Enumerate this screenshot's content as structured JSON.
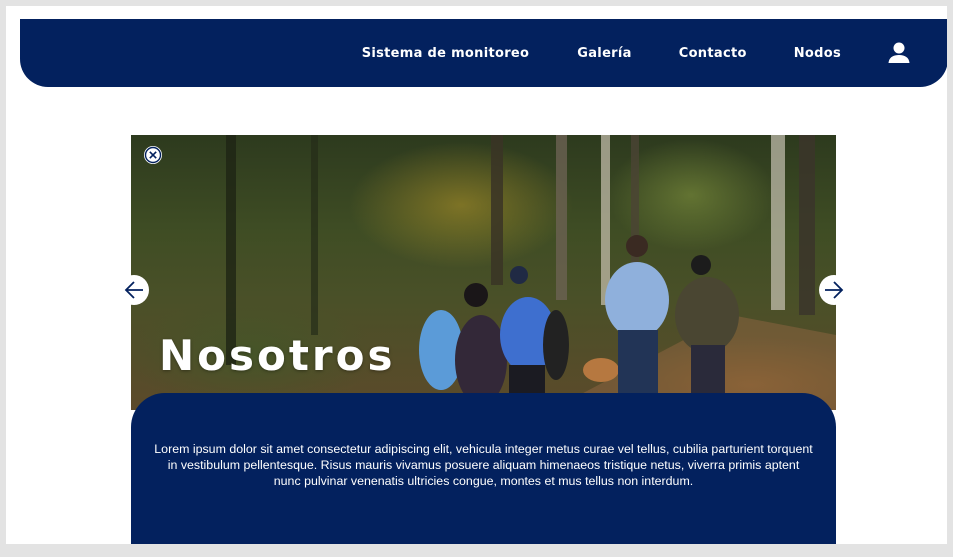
{
  "nav": {
    "links": [
      "Sistema de monitoreo",
      "Galería",
      "Contacto",
      "Nodos"
    ],
    "user_icon": "user-icon"
  },
  "hero": {
    "title": "Nosotros",
    "body": "Lorem ipsum dolor sit amet consectetur adipiscing elit, vehicula integer metus curae vel tellus, cubilia parturient torquent in vestibulum pellentesque. Risus mauris vivamus posuere aliquam himenaeos tristique netus, viverra primis aptent nunc pulvinar venenatis ultricies congue, montes et mus tellus non interdum.",
    "close_icon": "close-icon",
    "prev_icon": "arrow-left-icon",
    "next_icon": "arrow-right-icon"
  },
  "colors": {
    "primary": "#03215e",
    "background": "#ffffff",
    "frame": "#e3e3e3"
  }
}
